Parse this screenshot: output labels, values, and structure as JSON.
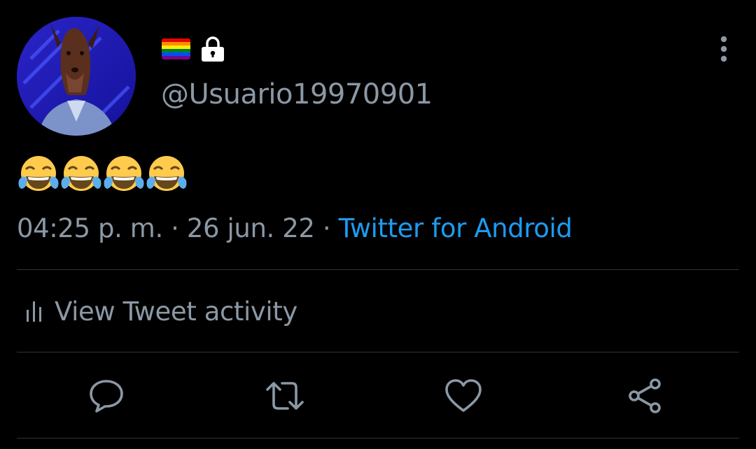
{
  "tweet": {
    "handle": "@Usuario19970901",
    "emoji_text": "😂😂😂😂",
    "time": "04:25 p. m.",
    "separator": " · ",
    "date": "26 jun. 22",
    "source": "Twitter for Android",
    "source_color": "#1d9bf0"
  },
  "profile": {
    "flag_icon": "rainbow-flag-icon",
    "badge_icon": "lock-icon"
  },
  "activity": {
    "label": "View Tweet activity",
    "icon": "bar-chart-icon"
  },
  "actions": [
    {
      "name": "reply",
      "icon": "speech-bubble-icon"
    },
    {
      "name": "retweet",
      "icon": "retweet-arrows-icon"
    },
    {
      "name": "like",
      "icon": "heart-icon"
    },
    {
      "name": "share",
      "icon": "share-nodes-icon"
    }
  ],
  "colors": {
    "background": "#000000",
    "secondary_text": "#8b98a5",
    "divider": "#2f3336",
    "link": "#1d9bf0"
  }
}
